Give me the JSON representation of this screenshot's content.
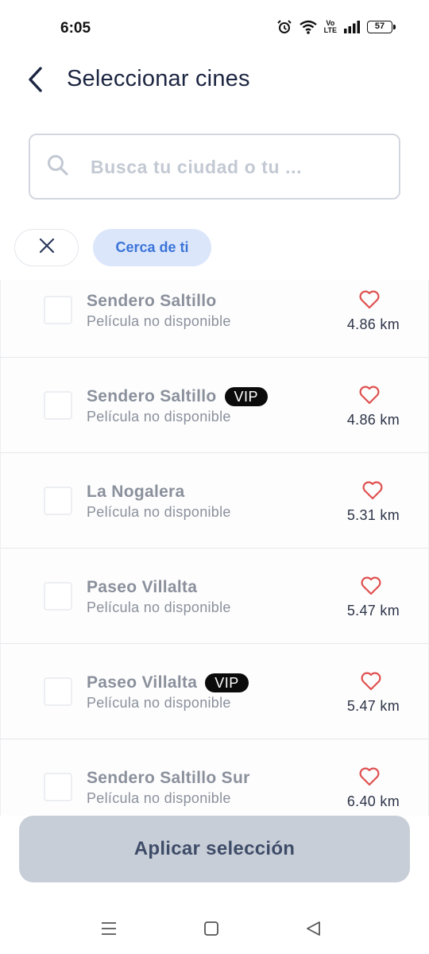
{
  "status_bar": {
    "time": "6:05",
    "lte_label_top": "Vo",
    "lte_label_bottom": "LTE",
    "battery": "57"
  },
  "header": {
    "title": "Seleccionar cines",
    "back_icon": "chevron-left-icon"
  },
  "search": {
    "placeholder": "Busca tu ciudad o tu ...",
    "value": "",
    "icon": "search-icon"
  },
  "filters": {
    "clear_icon": "close-icon",
    "near_label": "Cerca de ti"
  },
  "cinemas": [
    {
      "name": "Sendero Saltillo",
      "vip": false,
      "vip_label": "",
      "status": "Película no disponible",
      "distance": "4.86 km"
    },
    {
      "name": "Sendero Saltillo",
      "vip": true,
      "vip_label": "VIP",
      "status": "Película no disponible",
      "distance": "4.86 km"
    },
    {
      "name": "La Nogalera",
      "vip": false,
      "vip_label": "",
      "status": "Película no disponible",
      "distance": "5.31 km"
    },
    {
      "name": "Paseo Villalta",
      "vip": false,
      "vip_label": "",
      "status": "Película no disponible",
      "distance": "5.47 km"
    },
    {
      "name": "Paseo Villalta",
      "vip": true,
      "vip_label": "VIP",
      "status": "Película no disponible",
      "distance": "5.47 km"
    },
    {
      "name": "Sendero Saltillo Sur",
      "vip": false,
      "vip_label": "",
      "status": "Película no disponible",
      "distance": "6.40 km"
    }
  ],
  "apply_button": {
    "label": "Aplicar selección"
  },
  "colors": {
    "heart": "#e05050",
    "chip_bg": "#dbe6fb",
    "chip_text": "#3b74d8",
    "apply_bg": "#c8ced8"
  }
}
